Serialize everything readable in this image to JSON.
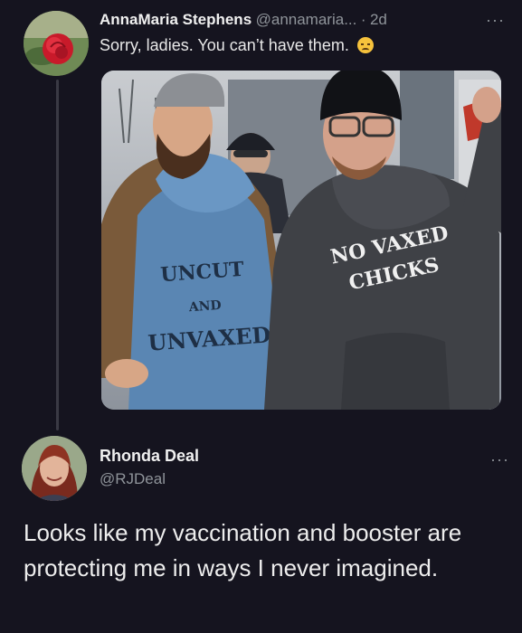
{
  "tweet": {
    "author_name": "AnnaMaria Stephens",
    "author_handle": "@annamaria...",
    "separator": "·",
    "time": "2d",
    "more_label": "···",
    "text": "Sorry, ladies. You can’t have them.",
    "emoji": "disappointed-face",
    "photo": {
      "left_shirt_lines": [
        "UNCUT",
        "AND",
        "UNVAXED"
      ],
      "right_shirt_lines": [
        "NO VAXED",
        "CHICKS"
      ]
    }
  },
  "reply": {
    "author_name": "Rhonda Deal",
    "author_handle": "@RJDeal",
    "more_label": "···",
    "text": "Looks like my vaccination and booster are protecting me in ways I never imagined."
  },
  "colors": {
    "background": "#15141f",
    "text_primary": "#e7e9ea",
    "text_secondary": "#8f949a",
    "thread_line": "#3a3a44"
  }
}
